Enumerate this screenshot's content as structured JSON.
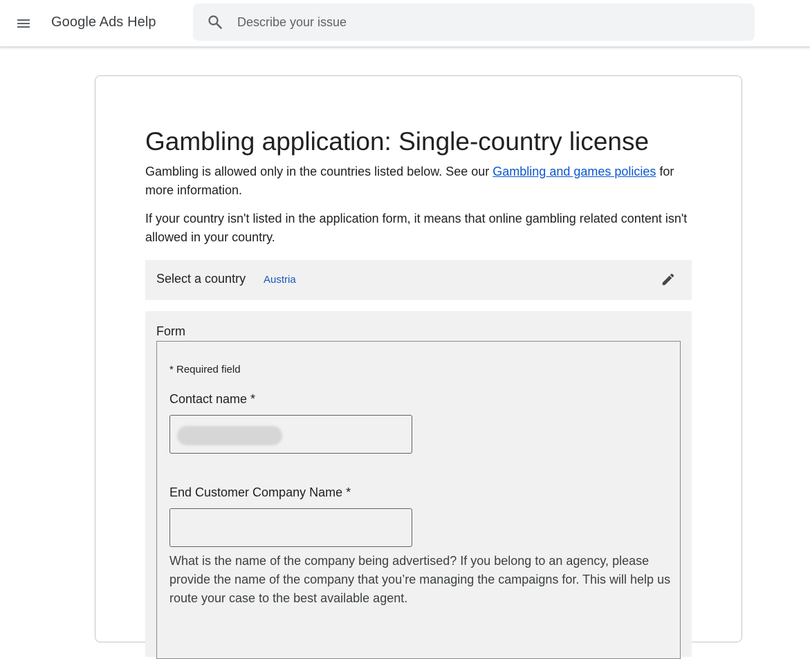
{
  "header": {
    "brand": "Google Ads Help",
    "search": {
      "placeholder": "Describe your issue"
    }
  },
  "icons": {
    "menu": "hamburger-menu-icon",
    "search": "search-icon",
    "edit": "pencil-icon"
  },
  "article": {
    "title": "Gambling application: Single-country license",
    "para1_before": "Gambling is allowed only in the countries listed below. See our ",
    "para1_link": "Gambling and games policies",
    "para1_after": " for more information.",
    "para2": "If your country isn't listed in the application form, it means that online gambling related content isn't allowed in your country."
  },
  "country_selector": {
    "label": "Select a country",
    "value": "Austria"
  },
  "form": {
    "section_label": "Form",
    "required_note": "* Required field",
    "contact_name": {
      "label": "Contact name *",
      "value": ""
    },
    "company_name": {
      "label": "End Customer Company Name *",
      "value": ""
    },
    "company_help": "What is the name of the company being advertised? If you belong to an agency, please provide the name of the company that you’re managing the campaigns for. This will help us route your case to the best available agent."
  },
  "colors": {
    "link": "#0b57d0",
    "country_value": "#1a57b8",
    "panel_bg": "#f1f1f1",
    "search_bg": "#f1f3f4"
  }
}
